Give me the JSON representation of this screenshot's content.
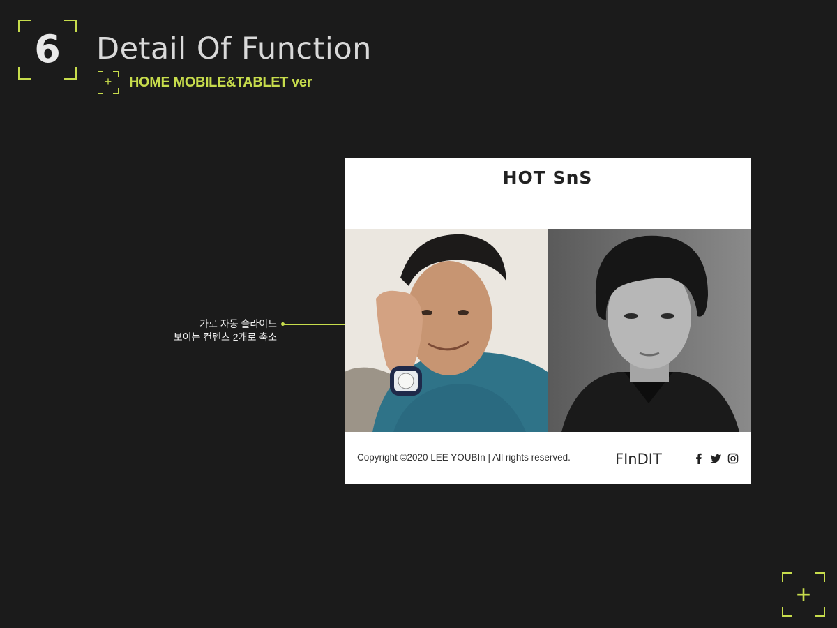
{
  "section": {
    "number": "6",
    "title": "Detail Of Function",
    "subtitle": "HOME MOBILE&TABLET ver",
    "plus_glyph": "+"
  },
  "annotation": {
    "line1": "가로 자동 슬라이드",
    "line2": "보이는 컨텐츠 2개로 축소"
  },
  "mockup": {
    "heading": "HOT SnS",
    "footer": {
      "copyright": "Copyright ©2020 LEE YOUBIn | All rights reserved.",
      "logo": "FInDIT",
      "social_icons": [
        "facebook-icon",
        "twitter-icon",
        "instagram-icon"
      ]
    }
  },
  "colors": {
    "background": "#1b1b1b",
    "accent": "#c7dc4c",
    "mockup_bg": "#ffffff"
  }
}
